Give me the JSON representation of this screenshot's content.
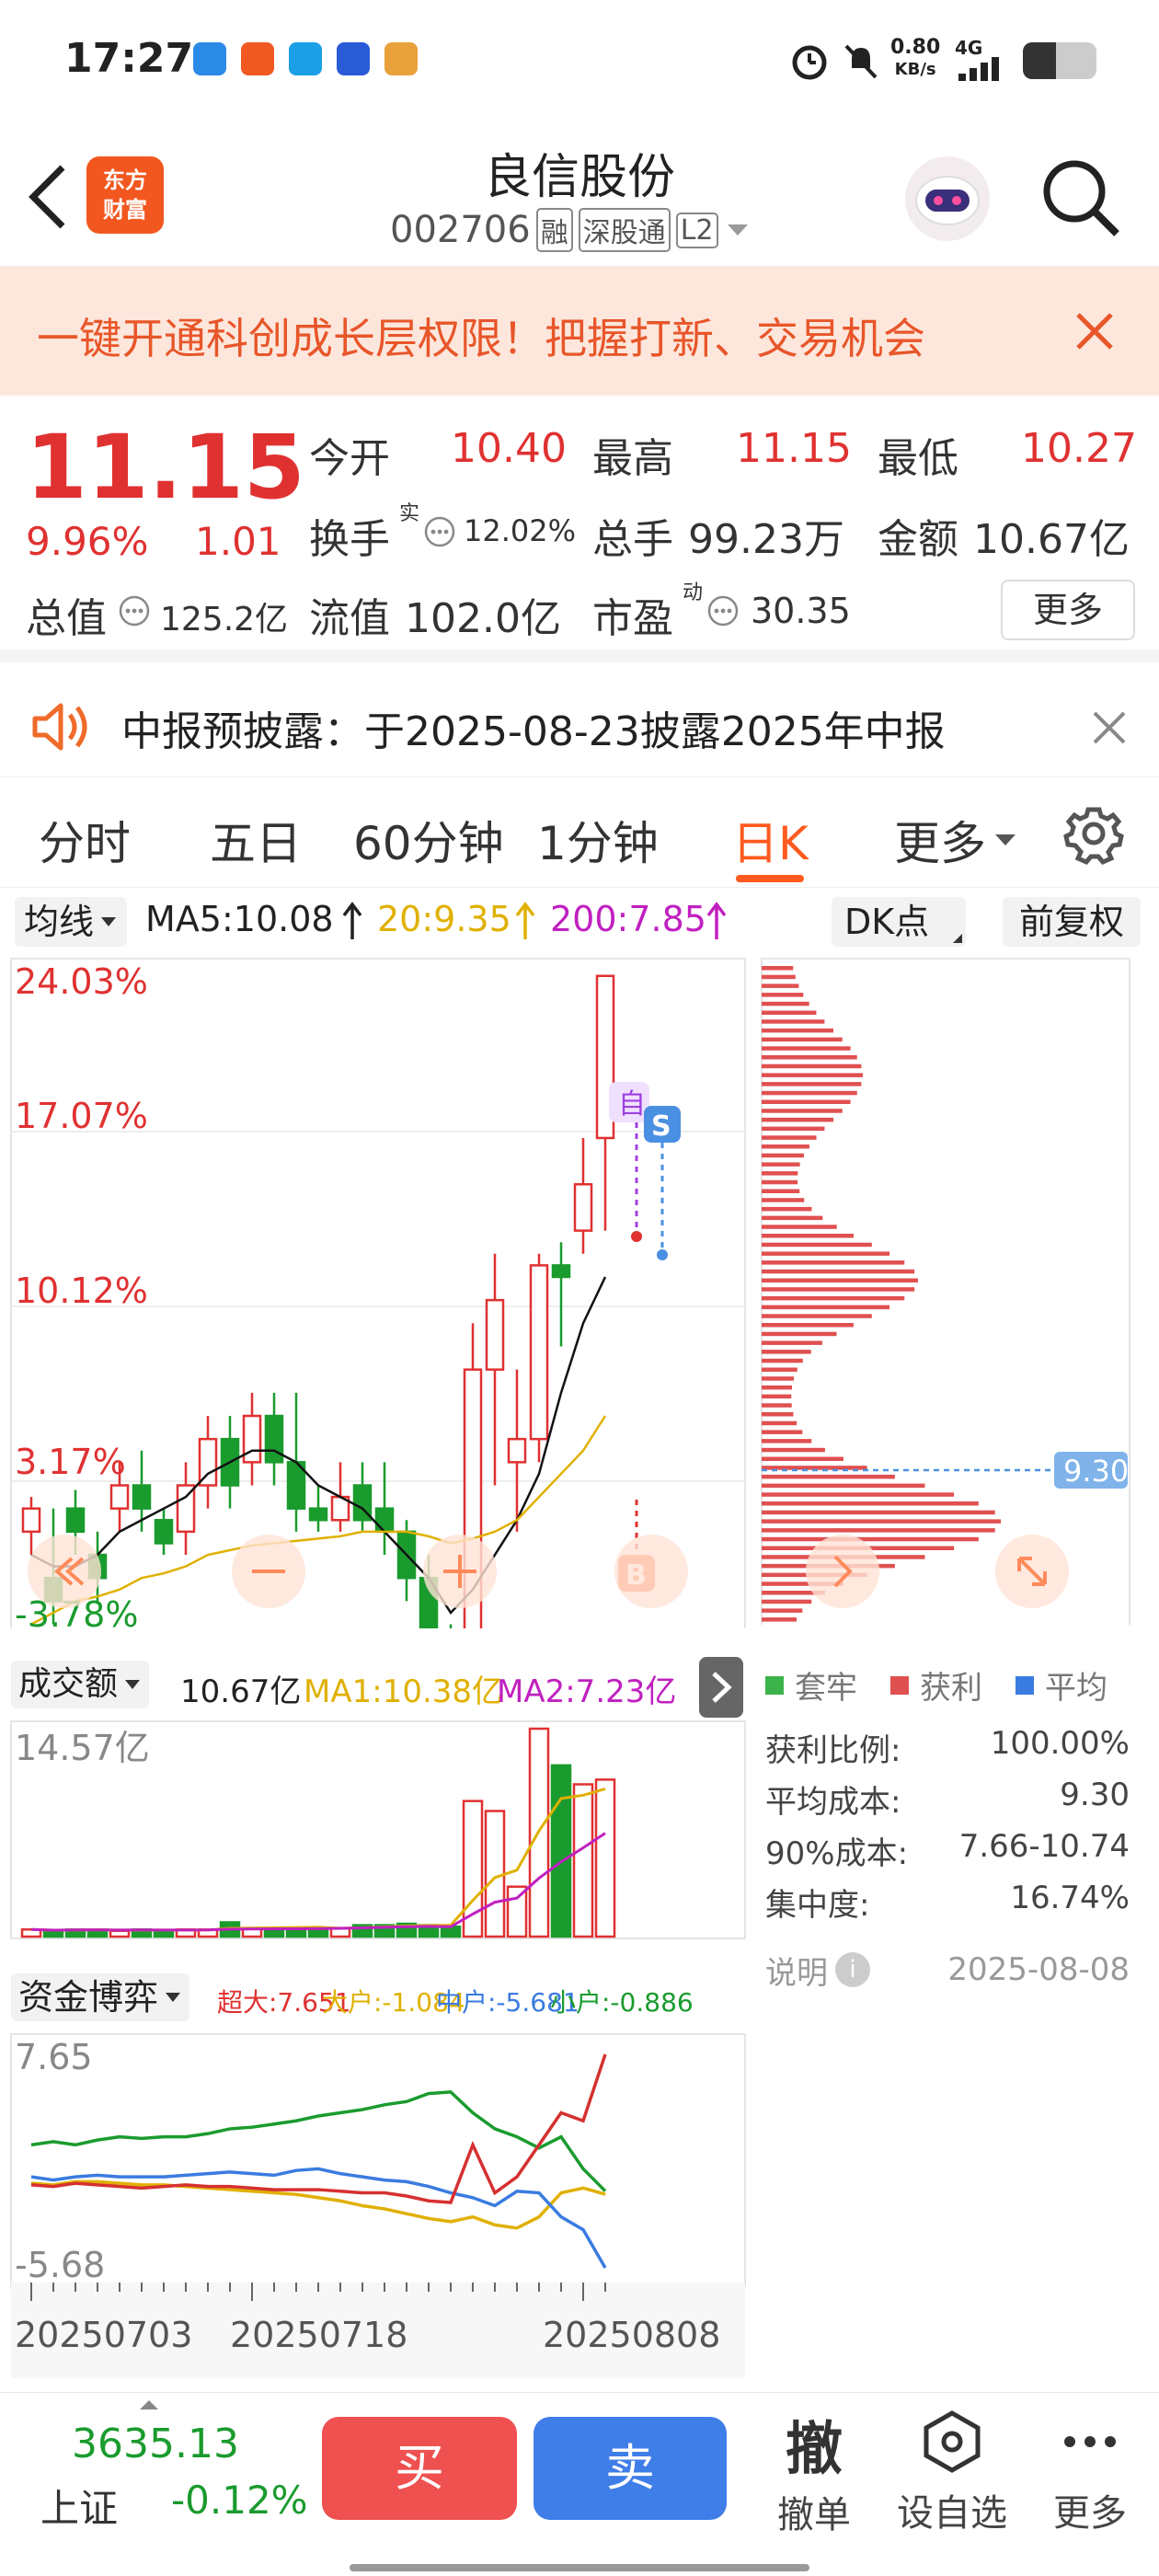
{
  "status": {
    "time": "17:27",
    "net_speed": "0.80",
    "net_unit": "KB/s",
    "network": "4G"
  },
  "header": {
    "back_label": "<",
    "logo_text": "东方\n财富",
    "title": "良信股份",
    "code": "002706",
    "tags": [
      "融",
      "深股通",
      "L2"
    ]
  },
  "banner": {
    "text": "一键开通科创成长层权限！把握打新、交易机会"
  },
  "quote": {
    "price": "11.15",
    "change_pct": "9.96%",
    "change": "1.01",
    "open_label": "今开",
    "open": "10.40",
    "high_label": "最高",
    "high": "11.15",
    "low_label": "最低",
    "low": "10.27",
    "turnover_label": "换手",
    "turnover_sup": "实",
    "turnover": "12.02%",
    "volume_label": "总手",
    "volume": "99.23万",
    "amount_label": "金额",
    "amount": "10.67亿",
    "mktcap_label": "总值",
    "mktcap": "125.2亿",
    "float_label": "流值",
    "float_cap": "102.0亿",
    "pe_label": "市盈",
    "pe_sup": "动",
    "pe": "30.35",
    "more_label": "更多"
  },
  "notice": {
    "text": "中报预披露：于2025-08-23披露2025年中报"
  },
  "tabs": [
    "分时",
    "五日",
    "60分钟",
    "1分钟",
    "日K",
    "更多"
  ],
  "active_tab": "日K",
  "kline": {
    "ma_select": "均线",
    "ma5": "MA5:10.08",
    "ma20": "20:9.35",
    "ma200": "200:7.85",
    "dk_label": "DK点",
    "fq_label": "前复权",
    "y_labels": [
      "24.03%",
      "17.07%",
      "10.12%",
      "3.17%",
      "-3.78%"
    ],
    "mark_zi": "自",
    "mark_s": "S",
    "mark_b": "B",
    "profile_price": "9.30"
  },
  "volume_panel": {
    "select": "成交额",
    "value": "10.67亿",
    "ma1": "MA1:10.38亿",
    "ma2": "MA2:7.23亿",
    "top_label": "14.57亿"
  },
  "fund_panel": {
    "select": "资金博弈",
    "super": "超大:7.651",
    "large": "大户:-1.084",
    "mid": "中户:-5.681",
    "small": "小户:-0.886",
    "top": "7.65",
    "bottom": "-5.68",
    "dates": [
      "20250703",
      "20250718",
      "20250808"
    ]
  },
  "chip": {
    "legend": [
      "套牢",
      "获利",
      "平均"
    ],
    "rows": [
      {
        "label": "获利比例:",
        "value": "100.00%"
      },
      {
        "label": "平均成本:",
        "value": "9.30"
      },
      {
        "label": "90%成本:",
        "value": "7.66-10.74"
      },
      {
        "label": "集中度:",
        "value": "16.74%"
      }
    ],
    "note_label": "说明",
    "date": "2025-08-08"
  },
  "bottom": {
    "index_value": "3635.13",
    "index_name": "上证",
    "index_change": "-0.12%",
    "buy": "买",
    "sell": "卖",
    "withdraw": "撤单",
    "withdraw_icon": "撤",
    "watch": "设自选",
    "more": "更多"
  },
  "colors": {
    "up": "#e03131",
    "down": "#1a9b2e",
    "ma20": "#e0b000",
    "ma200": "#c020c0",
    "accent": "#ff5a1f"
  },
  "chart_data": {
    "type": "candlestick",
    "candles_pct": [
      [
        0,
        1,
        -1,
        1.5
      ],
      [
        -2,
        -3,
        -4,
        1
      ],
      [
        1,
        0,
        -1,
        1.8
      ],
      [
        -1,
        -2,
        -3,
        0
      ],
      [
        1,
        2,
        0,
        3
      ],
      [
        2,
        1,
        0,
        3.5
      ],
      [
        0.5,
        -0.5,
        -1,
        1
      ],
      [
        0,
        2,
        -1,
        3
      ],
      [
        2,
        4,
        1,
        5
      ],
      [
        4,
        2,
        1,
        5
      ],
      [
        3,
        5,
        2,
        6
      ],
      [
        5,
        3,
        2,
        6
      ],
      [
        3,
        1,
        0,
        6
      ],
      [
        1,
        0.5,
        0,
        2
      ],
      [
        0.5,
        1.5,
        0,
        3
      ],
      [
        2,
        0.5,
        0,
        3
      ],
      [
        1,
        0,
        -1,
        3
      ],
      [
        0,
        -2,
        -3,
        0.5
      ],
      [
        -2,
        -5,
        -6,
        -1
      ],
      [
        -5,
        -6,
        -7,
        -4
      ],
      [
        -5,
        7,
        -5,
        9
      ],
      [
        7,
        10,
        2,
        12
      ],
      [
        3,
        4,
        0,
        7
      ],
      [
        4,
        11.5,
        3,
        12
      ],
      [
        11.5,
        11,
        8,
        12.5
      ],
      [
        13,
        15,
        12,
        17
      ],
      [
        17,
        24,
        13,
        24
      ]
    ],
    "ma5_pct": [
      -1,
      -1.5,
      -1.5,
      -1,
      0,
      0.5,
      1,
      1.5,
      2.5,
      3,
      3.5,
      3.5,
      3,
      2,
      1.5,
      1,
      0,
      -1,
      -2,
      -3.5,
      -2.5,
      -1,
      0.5,
      2.5,
      6,
      9,
      11
    ],
    "ma20_pct": [
      -4,
      -3.5,
      -3,
      -2.8,
      -2.5,
      -2,
      -1.8,
      -1.5,
      -1,
      -0.8,
      -0.6,
      -0.5,
      -0.4,
      -0.3,
      -0.2,
      0,
      0,
      0,
      -0.2,
      -0.5,
      -0.3,
      0,
      0.5,
      1.5,
      2.5,
      3.5,
      5
    ],
    "volume": [
      0.5,
      0.4,
      0.5,
      0.5,
      0.4,
      0.5,
      0.4,
      0.5,
      0.5,
      1,
      0.6,
      0.5,
      0.6,
      0.6,
      0.6,
      0.8,
      0.8,
      0.9,
      0.8,
      0.7,
      9.5,
      8.8,
      3.5,
      14.57,
      12,
      10.67,
      11
    ],
    "fund_super": [
      -0.5,
      -0.6,
      -0.4,
      -0.5,
      -0.6,
      -0.7,
      -0.6,
      -0.5,
      -0.6,
      -0.6,
      -0.7,
      -0.8,
      -0.8,
      -0.8,
      -0.9,
      -1,
      -1,
      -1.2,
      -1.5,
      -1.6,
      2,
      -1,
      0,
      2,
      4,
      3.5,
      7.65
    ],
    "fund_large": [
      -0.4,
      -0.5,
      -0.3,
      -0.3,
      -0.4,
      -0.5,
      -0.5,
      -0.6,
      -0.7,
      -0.8,
      -0.9,
      -1,
      -1.1,
      -1.3,
      -1.5,
      -1.8,
      -2,
      -2.3,
      -2.6,
      -2.8,
      -2.5,
      -3,
      -3.2,
      -2.5,
      -1,
      -0.7,
      -1.084
    ],
    "fund_mid": [
      0,
      -0.2,
      0,
      0.1,
      0,
      0,
      0,
      0.1,
      0.2,
      0.3,
      0.2,
      0.1,
      0.4,
      0.5,
      0.2,
      0,
      -0.2,
      -0.3,
      -0.6,
      -1,
      -1.3,
      -1.8,
      -0.9,
      -1,
      -2.5,
      -3.3,
      -5.681
    ],
    "fund_small": [
      2,
      2.2,
      2,
      2.3,
      2.5,
      2.4,
      2.5,
      2.5,
      2.7,
      3,
      3.1,
      3.3,
      3.5,
      3.8,
      4,
      4.2,
      4.5,
      4.7,
      5.2,
      5.3,
      4,
      3,
      2.5,
      1.8,
      2.5,
      0.5,
      -0.886
    ]
  }
}
